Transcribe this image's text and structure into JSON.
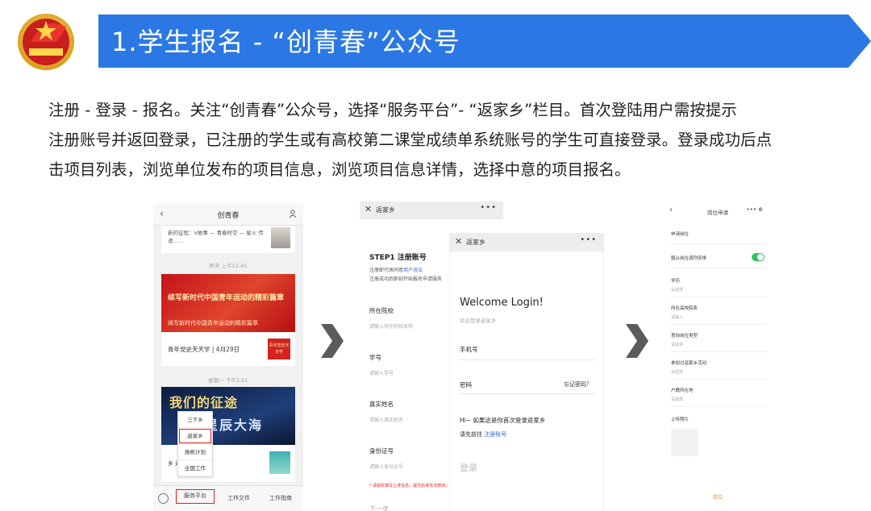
{
  "header": {
    "title": "1.学生报名  -  “创青春”公众号"
  },
  "description": {
    "line1": "注册 - 登录 - 报名。关注“创青春”公众号，选择“服务平台”- “返家乡”栏目。首次登陆用户需按提示",
    "line2": "注册账号并返回登录，已注册的学生或有高校第二课堂成绩单系统账号的学生可直接登录。登录成功后点",
    "line3": "击项目列表，浏览单位发布的项目信息，浏览项目信息详情，选择中意的项目报名。"
  },
  "screen1": {
    "title": "创青春",
    "back_glyph": "‹",
    "card1_text": "新的征程：V故事 — 青春时空 — 星火 传递……",
    "date1": "昨天 上午11:45",
    "banner1_line1": "续写新时代中国青年运动的精彩篇章",
    "banner1_line2": "续写新时代中国青年运动的精彩篇章",
    "card2_caption": "青年党史天天学 | 4月29日",
    "card2_badge": "青年党史天天学",
    "date2": "星期一 下午5:51",
    "banner2_line1": "我们的征途",
    "banner2_line2": "星辰大海",
    "card3_row": "乡             返回",
    "menu_items": [
      "三下乡",
      "返家乡",
      "扬帆计划",
      "全国工作"
    ],
    "tabs": [
      "服务平台",
      "工作文件",
      "工作指南"
    ]
  },
  "screen2": {
    "title": "返家乡",
    "close_glyph": "✕",
    "dots": "•••",
    "step": "STEP1 注册账号",
    "agree_prefix": "注册即代表同意",
    "agree_link": "用户协议",
    "agree_note": "注册成功后即刻开始报名申请服务",
    "fields": [
      {
        "label": "所在院校",
        "placeholder": "请输入所在院校名称"
      },
      {
        "label": "学号",
        "placeholder": "请输入学号"
      },
      {
        "label": "真实姓名",
        "placeholder": "请输入真实姓名"
      },
      {
        "label": "身份证号",
        "placeholder": "请输入身份证号"
      }
    ],
    "warning": "* 请如实填写上述信息，提交后将无法修改；请确保所填信息真实有效",
    "next": "下一步"
  },
  "screen3": {
    "title": "返家乡",
    "close_glyph": "✕",
    "dots": "•••",
    "welcome": "Welcome Login!",
    "subtitle": "欢迎登录返家乡",
    "phone_label": "手机号",
    "password_label": "密码",
    "forgot": "忘记密码？",
    "hint": "Hi~ 如果这是你首次登录返家乡",
    "register_prefix": "请先前往",
    "register_link": "注册账号",
    "login_button": "登录"
  },
  "screen4": {
    "title": "岗位申请",
    "back_glyph": "‹",
    "dots": "•••  ⊕",
    "fields": [
      {
        "label": "申请岗位",
        "value": ""
      },
      {
        "label": "服从岗位调剂安排",
        "value": ""
      },
      {
        "label": "学历",
        "value": "请选择"
      },
      {
        "label": "所在高校院系",
        "value": "请输入"
      },
      {
        "label": "意向岗位类型",
        "value": "请选择"
      },
      {
        "label": "参加过返家乡活动",
        "value": "请选择"
      },
      {
        "label": "户籍所在地",
        "value": "请选择"
      },
      {
        "label": "上传照片",
        "value": ""
      }
    ],
    "submit": "提交"
  },
  "colors": {
    "banner_blue": "#2b78e4",
    "accent_red": "#e02020",
    "link_blue": "#2f6bd8",
    "toggle_green": "#33c25a"
  }
}
